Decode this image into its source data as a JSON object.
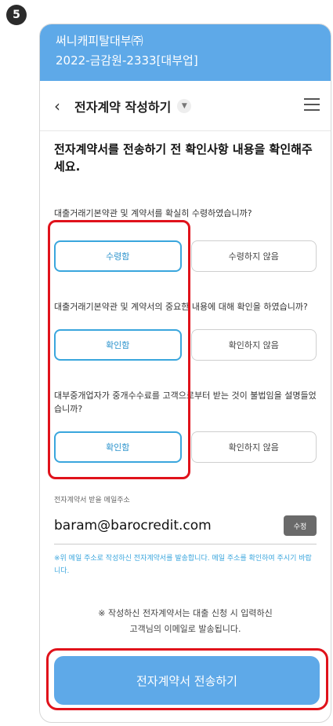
{
  "step_number": "5",
  "banner": {
    "company": "써니캐피탈대부㈜",
    "registration": "2022-금감원-2333[대부업]"
  },
  "topbar": {
    "title": "전자계약 작성하기"
  },
  "headline": "전자계약서를 전송하기 전 확인사항 내용을 확인해주세요.",
  "questions": [
    {
      "text": "대출거래기본약관 및 계약서를 확실히 수령하였습니까?",
      "selected_label": "수령함",
      "unselected_label": "수령하지 않음"
    },
    {
      "text": "대출거래기본약관 및 계약서의 중요한 내용에 대해 확인을 하였습니까?",
      "selected_label": "확인함",
      "unselected_label": "확인하지 않음"
    },
    {
      "text": "대부중개업자가 중개수수료를 고객으로부터 받는 것이 불법임을 설명들었습니까?",
      "selected_label": "확인함",
      "unselected_label": "확인하지 않음"
    }
  ],
  "email": {
    "label": "전자계약서 받을 메일주소",
    "value": "baram@barocredit.com",
    "edit_label": "수정",
    "note": "※위 메일 주소로 작성하신 전자계약서를 발송합니다. 메일 주소를 확인하여 주시기 바랍니다."
  },
  "notice": {
    "line1": "※ 작성하신 전자계약서는 대출 신청 시 입력하신",
    "line2": "고객님의 이메일로 발송됩니다."
  },
  "send_button_label": "전자계약서 전송하기",
  "colors": {
    "brand_blue": "#5ea9e8",
    "selected_border": "#3aa6dd",
    "highlight_red": "#e0121b"
  }
}
